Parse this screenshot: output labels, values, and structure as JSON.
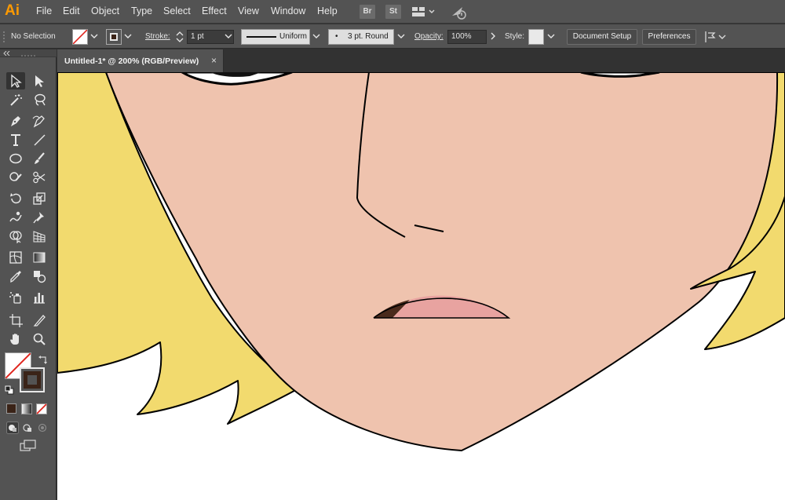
{
  "app": {
    "logo": "Ai"
  },
  "menu": [
    "File",
    "Edit",
    "Object",
    "Type",
    "Select",
    "Effect",
    "View",
    "Window",
    "Help"
  ],
  "app_badges": {
    "bridge": "Br",
    "stock": "St"
  },
  "control_bar": {
    "selection": "No Selection",
    "stroke_label": "Stroke:",
    "stroke_weight": "1 pt",
    "stroke_profile": "Uniform",
    "brush": "3 pt. Round",
    "brush_dot": "•",
    "opacity_label": "Opacity:",
    "opacity_value": "100%",
    "style_label": "Style:",
    "document_setup": "Document Setup",
    "preferences": "Preferences"
  },
  "document_tab": {
    "title": "Untitled-1* @ 200% (RGB/Preview)",
    "close": "×"
  },
  "tools": [
    "selection-tool",
    "direct-selection-tool",
    "magic-wand-tool",
    "lasso-tool",
    "pen-tool",
    "curvature-tool",
    "type-tool",
    "line-segment-tool",
    "ellipse-tool",
    "paintbrush-tool",
    "shaper-tool",
    "scissors-tool",
    "rotate-tool",
    "scale-tool",
    "warp-tool",
    "puppet-warp-tool",
    "shape-builder-tool",
    "perspective-grid-tool",
    "mesh-tool",
    "gradient-tool",
    "eyedropper-tool",
    "blend-tool",
    "symbol-sprayer-tool",
    "column-graph-tool",
    "artboard-tool",
    "slice-tool",
    "hand-tool",
    "zoom-tool"
  ],
  "colors": {
    "skin": "#efc3ae",
    "hair": "#f2da6e",
    "lip_pink": "#e8a3a0",
    "lip_dark": "#4a2a1c",
    "stroke_swatch": "#3a2317",
    "accent": "#ff9a00"
  }
}
